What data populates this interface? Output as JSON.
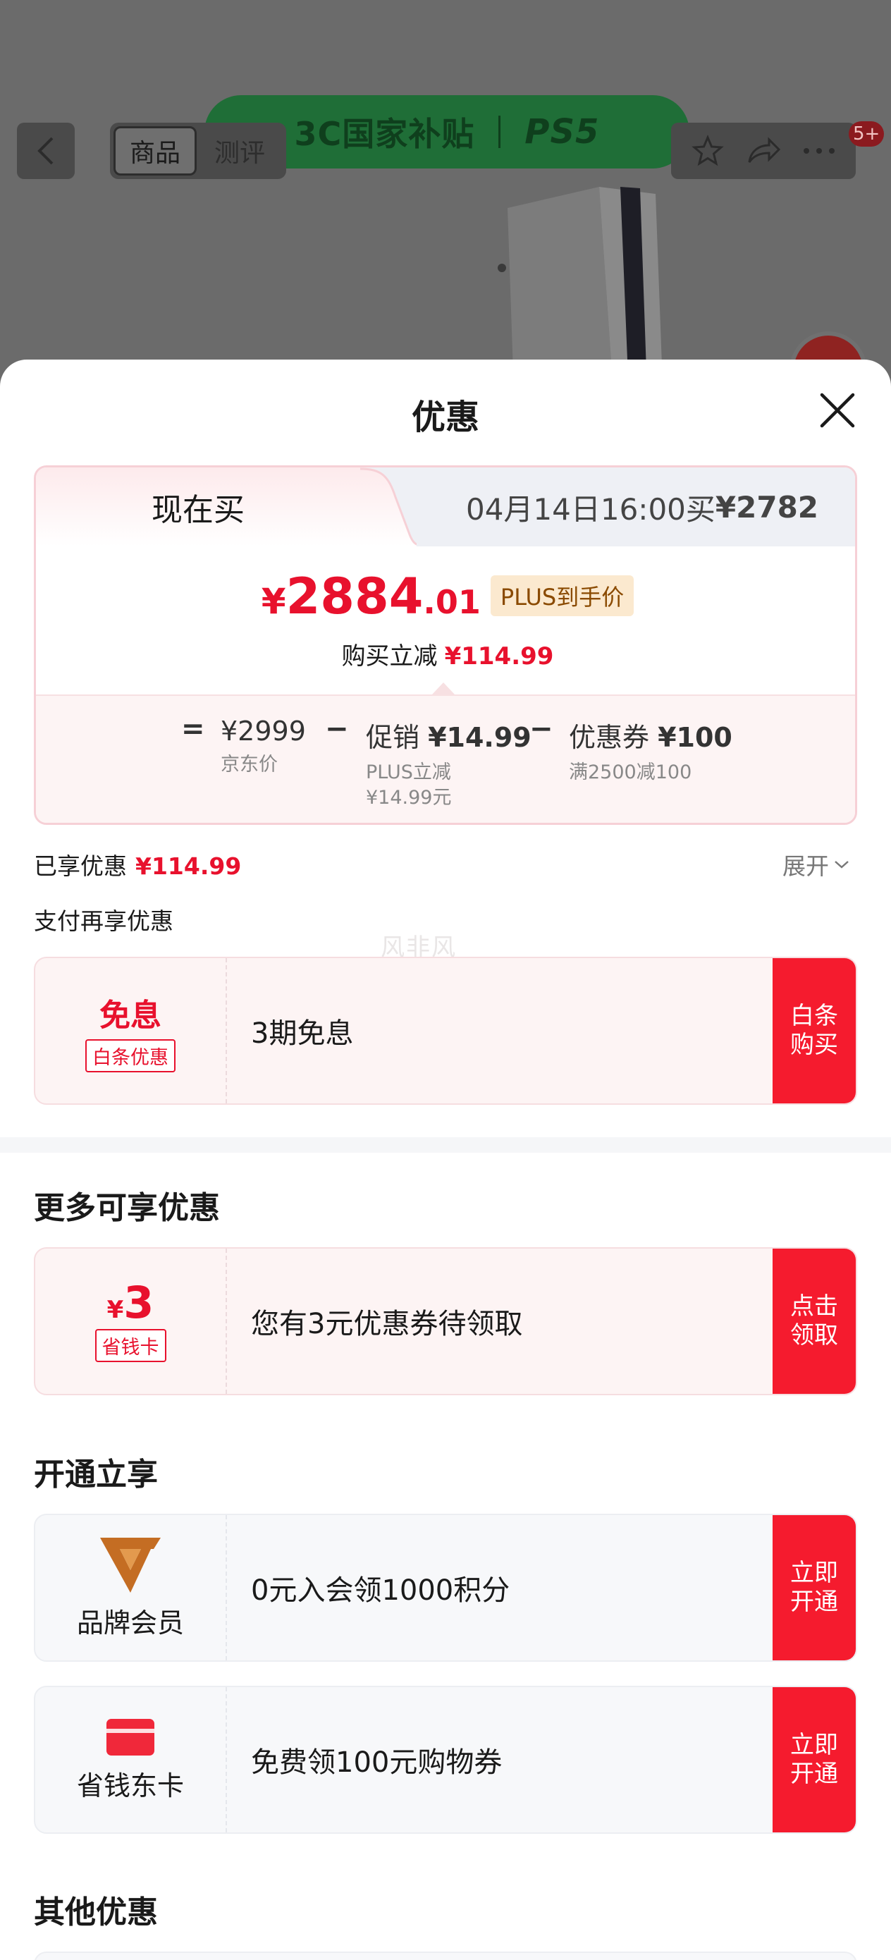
{
  "background_page": {
    "banner_left": "3C国家补贴",
    "banner_right": "PS5",
    "tabs": [
      "商品",
      "测评"
    ],
    "badge": "5+",
    "icons": [
      "back-arrow-icon",
      "star-icon",
      "share-icon",
      "more-icon"
    ]
  },
  "sheet": {
    "title": "优惠",
    "close_icon": "close-icon"
  },
  "price_card": {
    "tab_now": "现在买",
    "tab_later_prefix": "04月14日16:00买",
    "tab_later_price": "¥2782",
    "price_yen": "¥",
    "price_int": "2884",
    "price_dec": ".01",
    "price_tag": "PLUS到手价",
    "instant_label": "购买立减",
    "instant_value": "¥114.99",
    "breakdown": {
      "eq": "=",
      "jd_price": "¥2999",
      "jd_label": "京东价",
      "minus1": "−",
      "promo_label": "促销",
      "promo_value": "¥14.99",
      "promo_sub1": "PLUS立减",
      "promo_sub2": "¥14.99元",
      "minus2": "−",
      "coupon_label": "优惠券",
      "coupon_value": "¥100",
      "coupon_sub": "满2500减100"
    }
  },
  "enjoyed": {
    "label": "已享优惠",
    "value": "¥114.99",
    "expand": "展开"
  },
  "pay_more": {
    "title": "支付再享优惠",
    "watermark": "风非风",
    "card": {
      "big": "免息",
      "tag": "白条优惠",
      "text": "3期免息",
      "button": "白条购买"
    }
  },
  "more_offers": {
    "title": "更多可享优惠",
    "card": {
      "yen": "¥",
      "amount": "3",
      "tag": "省钱卡",
      "text": "您有3元优惠券待领取",
      "button": "点击领取"
    }
  },
  "open_enjoy": {
    "title": "开通立享",
    "cards": [
      {
        "label": "品牌会员",
        "text": "0元入会领1000积分",
        "button": "立即开通",
        "icon": "brand-v-logo-icon"
      },
      {
        "label": "省钱东卡",
        "text": "免费领100元购物券",
        "button": "立即开通",
        "icon": "red-card-icon"
      }
    ]
  },
  "other": {
    "title": "其他优惠"
  },
  "colors": {
    "accent_red": "#e8112d",
    "button_red": "#f51b2e",
    "plus_tag_bg": "#fbe9cf"
  }
}
